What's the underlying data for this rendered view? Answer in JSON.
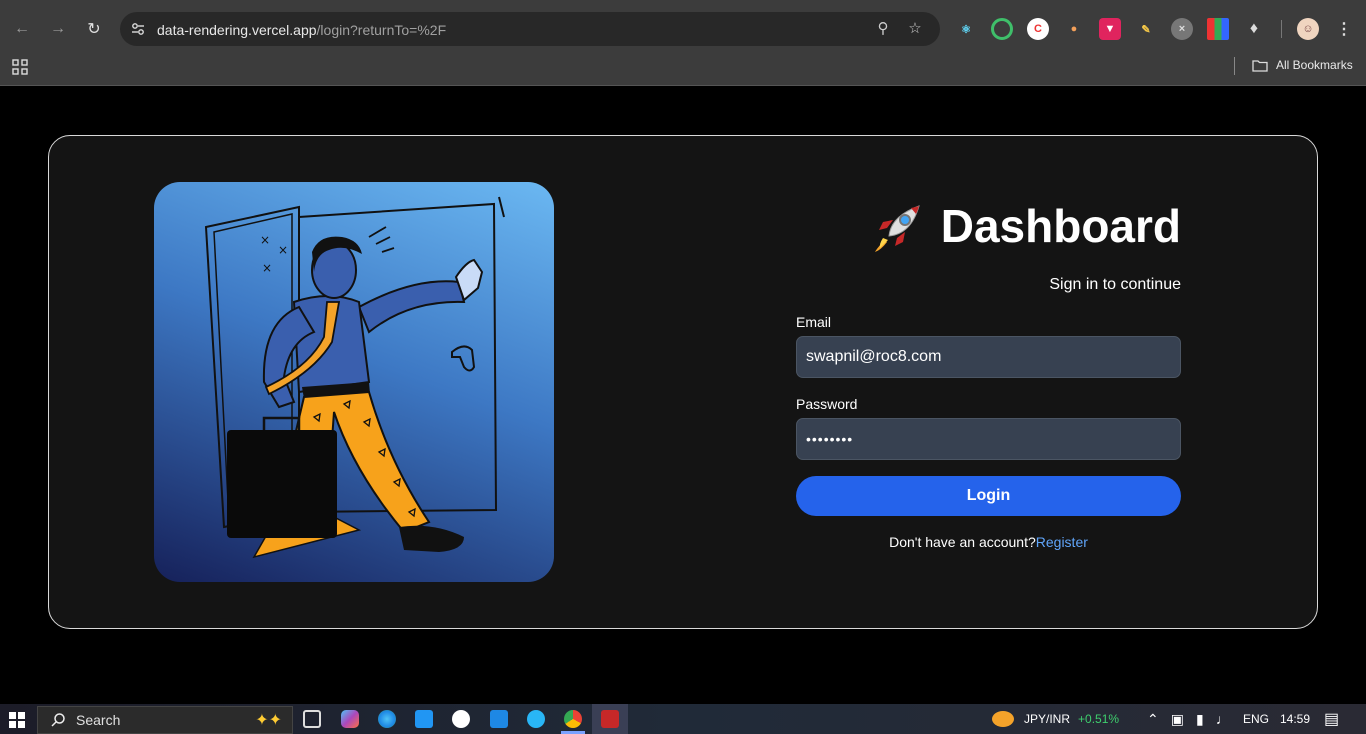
{
  "browser": {
    "url_host": "data-rendering.vercel.app",
    "url_path": "/login?returnTo=%2F",
    "all_bookmarks": "All Bookmarks"
  },
  "login": {
    "title": "Dashboard",
    "subtitle": "Sign in to continue",
    "email_label": "Email",
    "email_value": "swapnil@roc8.com",
    "password_label": "Password",
    "password_value": "••••••••",
    "login_button": "Login",
    "no_account_text": "Don't have an account?",
    "register_link": "Register"
  },
  "taskbar": {
    "search_placeholder": "Search",
    "ticker": "JPY/INR",
    "ticker_change": "+0.51%",
    "language": "ENG",
    "time": "14:59"
  },
  "colors": {
    "accent": "#2563eb",
    "link": "#60a5fa",
    "input_bg": "#374151",
    "card_bg": "#141414"
  }
}
